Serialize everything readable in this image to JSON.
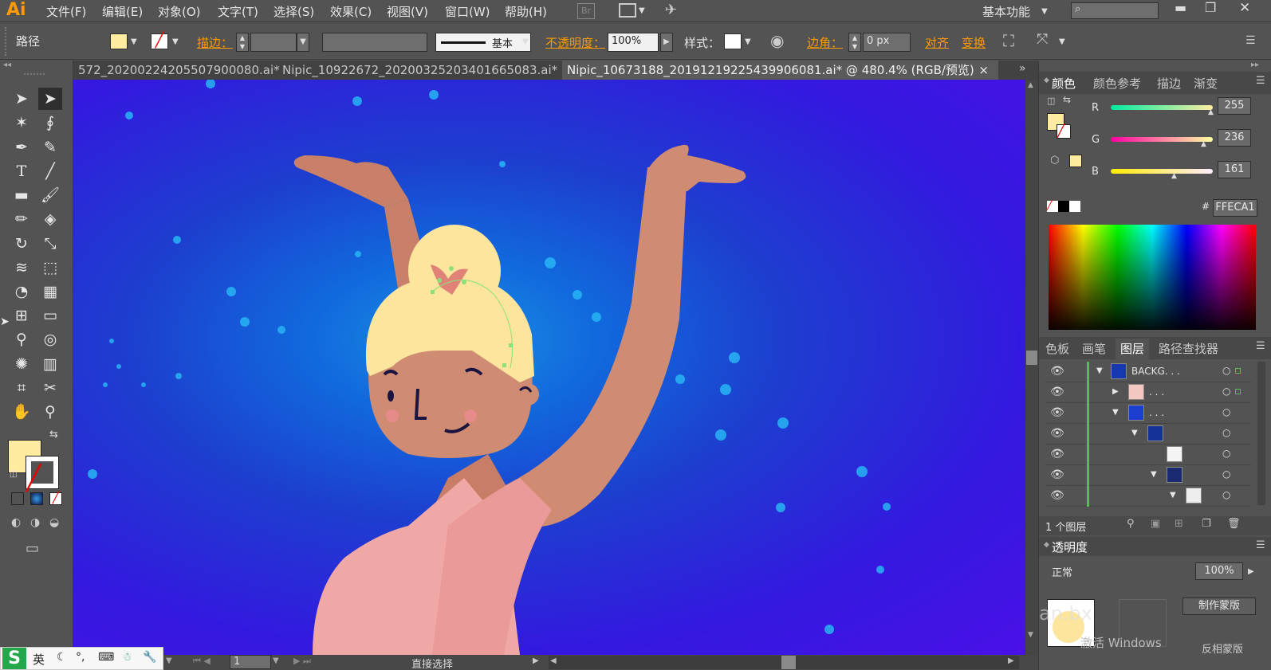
{
  "app": {
    "logo": "Ai"
  },
  "menu": [
    "文件(F)",
    "编辑(E)",
    "对象(O)",
    "文字(T)",
    "选择(S)",
    "效果(C)",
    "视图(V)",
    "窗口(W)",
    "帮助(H)"
  ],
  "menu_right": {
    "workspace": "基本功能",
    "bridge": "Br"
  },
  "control": {
    "selection_label": "路径",
    "stroke_label": "描边：",
    "stroke_style": "基本",
    "opacity_label": "不透明度：",
    "opacity_value": "100%",
    "style_label": "样式：",
    "corner_label": "边角：",
    "corner_value": "0 px",
    "align_label": "对齐",
    "transform_label": "变换"
  },
  "tabs": [
    "572_20200224205507900080.ai*",
    "Nipic_10922672_20200325203401665083.ai*",
    "Nipic_10673188_20191219225439906081.ai* @ 480.4% (RGB/预览)"
  ],
  "color_panel": {
    "tabs": [
      "颜色",
      "颜色参考",
      "描边",
      "渐变"
    ],
    "r_label": "R",
    "g_label": "G",
    "b_label": "B",
    "r": "255",
    "g": "236",
    "b": "161",
    "hex_label": "#",
    "hex": "FFECA1",
    "fill_color": "#FFECA1"
  },
  "layers_panel": {
    "tabs": [
      "色板",
      "画笔",
      "图层",
      "路径查找器"
    ],
    "top_layer": "BACKG. . .",
    "sub1": ". . .",
    "sub2": ". . .",
    "count": "1 个图层"
  },
  "transparency_panel": {
    "title": "透明度",
    "blend": "正常",
    "opacity": "100%",
    "make_mask": "制作蒙版",
    "invert_mask": "反相蒙版"
  },
  "status": {
    "page": "1",
    "tool": "直接选择"
  },
  "ime": {
    "lang": "英"
  },
  "watermark": {
    "activate": "激活 Windows",
    "site": "an.bx"
  }
}
